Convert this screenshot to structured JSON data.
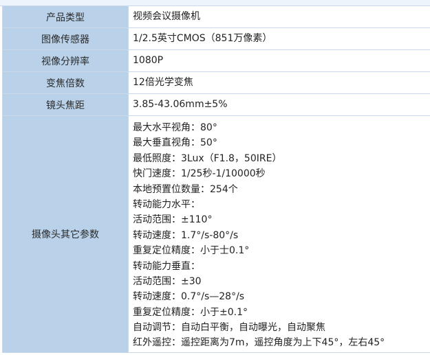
{
  "rows": [
    {
      "label": "产品类型",
      "value": "视频会议摄像机"
    },
    {
      "label": "图像传感器",
      "value": "1/2.5英寸CMOS（851万像素）"
    },
    {
      "label": "视像分辨率",
      "value": "1080P"
    },
    {
      "label": "变焦倍数",
      "value": "12倍光学变焦"
    },
    {
      "label": "镜头焦距",
      "value": "3.85-43.06mm±5%"
    }
  ],
  "other": {
    "label": "摄像头其它参数",
    "lines": [
      "最大水平视角：80°",
      "最大垂直视角：50°",
      "最低照度：3Lux（F1.8，50IRE）",
      "快门速度：1/25秒-1/10000秒",
      "本地预置位数量：254个",
      "转动能力水平：",
      "活动范围：±110°",
      "转动速度：1.7°/s-80°/s",
      "重复定位精度：小于士0.1°",
      "转动能力垂直：",
      "活动范围：±30",
      "转动速度：0.7°/s—28°/s",
      "重复定位精度：小于±0.1°",
      "自动调节：自动白平衡，自动曝光，自动聚焦",
      "红外遥控：遥控距离为7m，遥控角度为上下45°，左右45°"
    ]
  }
}
